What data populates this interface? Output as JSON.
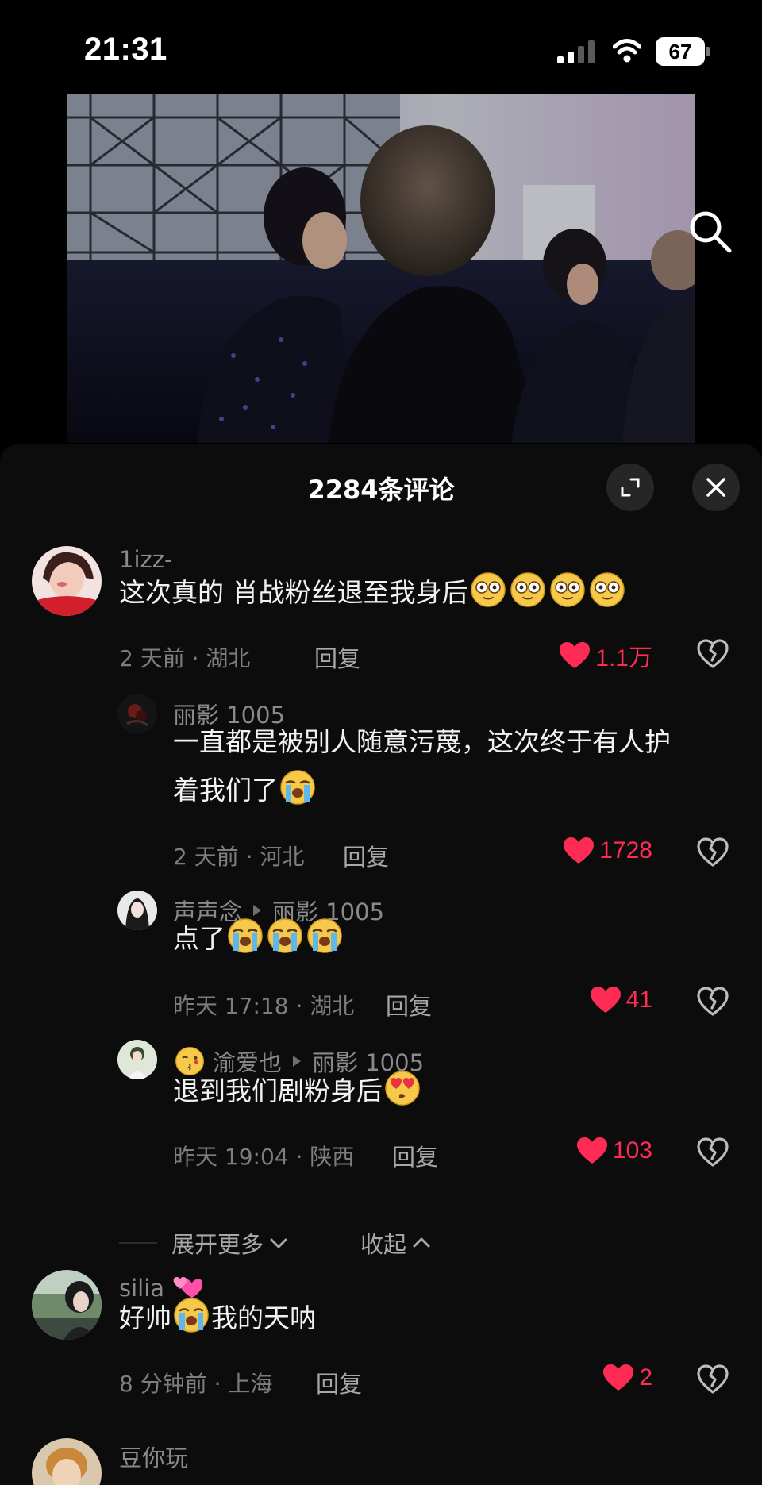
{
  "status_bar": {
    "time": "21:31",
    "battery": "67"
  },
  "panel": {
    "title": "2284条评论"
  },
  "comments": [
    {
      "author": "1izz-",
      "text": "这次真的 肖战粉丝退至我身后",
      "meta": "2 天前 · 湖北",
      "reply": "回复",
      "likes": "1.1万"
    },
    {
      "author": "丽影 1005",
      "text_line1": "一直都是被别人随意污蔑，这次终于有人护",
      "text_line2": "着我们了",
      "meta": "2 天前 · 河北",
      "reply": "回复",
      "likes": "1728"
    },
    {
      "author": "声声念",
      "reply_to": "丽影 1005",
      "text": "点了",
      "meta": "昨天 17:18 · 湖北",
      "reply": "回复",
      "likes": "41"
    },
    {
      "author": "渝爱也",
      "reply_to": "丽影 1005",
      "text": "退到我们剧粉身后",
      "meta": "昨天 19:04 · 陕西",
      "reply": "回复",
      "likes": "103"
    },
    {
      "author": "silia",
      "text_a": "好帅",
      "text_b": "我的天呐",
      "meta": "8 分钟前 · 上海",
      "reply": "回复",
      "likes": "2"
    },
    {
      "author": "豆你玩"
    }
  ],
  "thread": {
    "expand": "展开更多",
    "collapse": "收起"
  },
  "colors": {
    "like": "#fe2c55",
    "panel_bg": "#0c0c0c",
    "muted": "#8a8a8a"
  }
}
